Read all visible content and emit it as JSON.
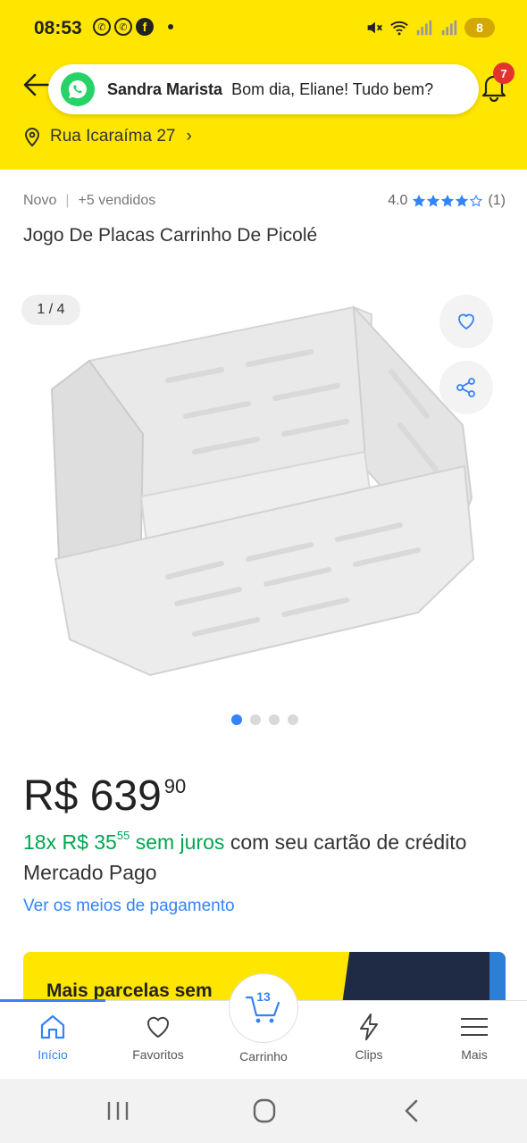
{
  "status_bar": {
    "time": "08:53",
    "battery": "8"
  },
  "notification": {
    "sender": "Sandra Marista",
    "message": "Bom dia, Eliane! Tudo bem?"
  },
  "header": {
    "bell_badge": "7",
    "address": "Rua Icaraíma 27",
    "accent": "#ffe600"
  },
  "product": {
    "condition": "Novo",
    "sold": "+5 vendidos",
    "rating_value": "4.0",
    "rating_stars": 4,
    "rating_count": "(1)",
    "title": "Jogo De Placas Carrinho De Picolé",
    "image_counter": "1 / 4",
    "image_count": 4,
    "image_active": 1
  },
  "price": {
    "main": "R$ 639",
    "cents": "90",
    "installments_count": "18x R$ 35",
    "installments_cents": "55",
    "interest": "sem juros",
    "installments_rest": "com seu cartão de crédito Mercado Pago",
    "payment_link": "Ver os meios de pagamento"
  },
  "banner": {
    "text": "Mais parcelas sem"
  },
  "bottom_nav": {
    "items": [
      {
        "label": "Início",
        "icon": "home-icon",
        "active": true
      },
      {
        "label": "Favoritos",
        "icon": "heart-icon",
        "active": false
      },
      {
        "label": "Carrinho",
        "icon": "cart-icon",
        "active": false,
        "count": "13"
      },
      {
        "label": "Clips",
        "icon": "lightning-icon",
        "active": false
      },
      {
        "label": "Mais",
        "icon": "menu-icon",
        "active": false
      }
    ]
  },
  "colors": {
    "brand_yellow": "#ffe600",
    "link_blue": "#3483fa",
    "success_green": "#00a650",
    "badge_red": "#e4322f"
  }
}
